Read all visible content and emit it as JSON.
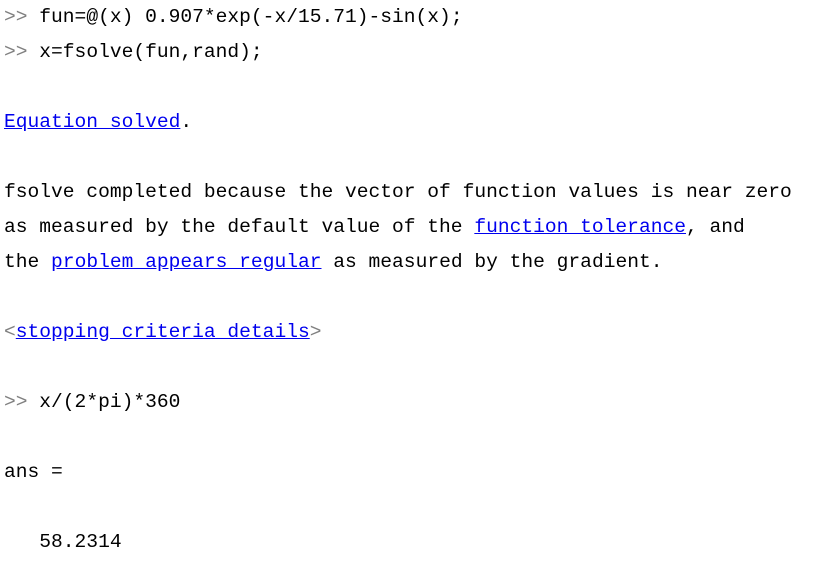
{
  "prompt": ">> ",
  "commands": [
    "fun=@(x) 0.907*exp(-x/15.71)-sin(x);",
    "x=fsolve(fun,rand);",
    "x/(2*pi)*360"
  ],
  "output": {
    "equation_solved_link": "Equation solved",
    "period": ".",
    "line1": "fsolve completed because the vector of function values is near zero",
    "line2_pre": "as measured by the default value of the ",
    "function_tolerance_link": "function tolerance",
    "line2_post": ", and",
    "line3_pre": "the ",
    "problem_regular_link": "problem appears regular",
    "line3_post": " as measured by the gradient.",
    "open_bracket": "<",
    "stopping_criteria_link": "stopping criteria details",
    "close_bracket": ">",
    "ans_label": "ans =",
    "ans_value": "   58.2314"
  },
  "colors": {
    "link": "#0000ee",
    "prompt": "#808080"
  }
}
